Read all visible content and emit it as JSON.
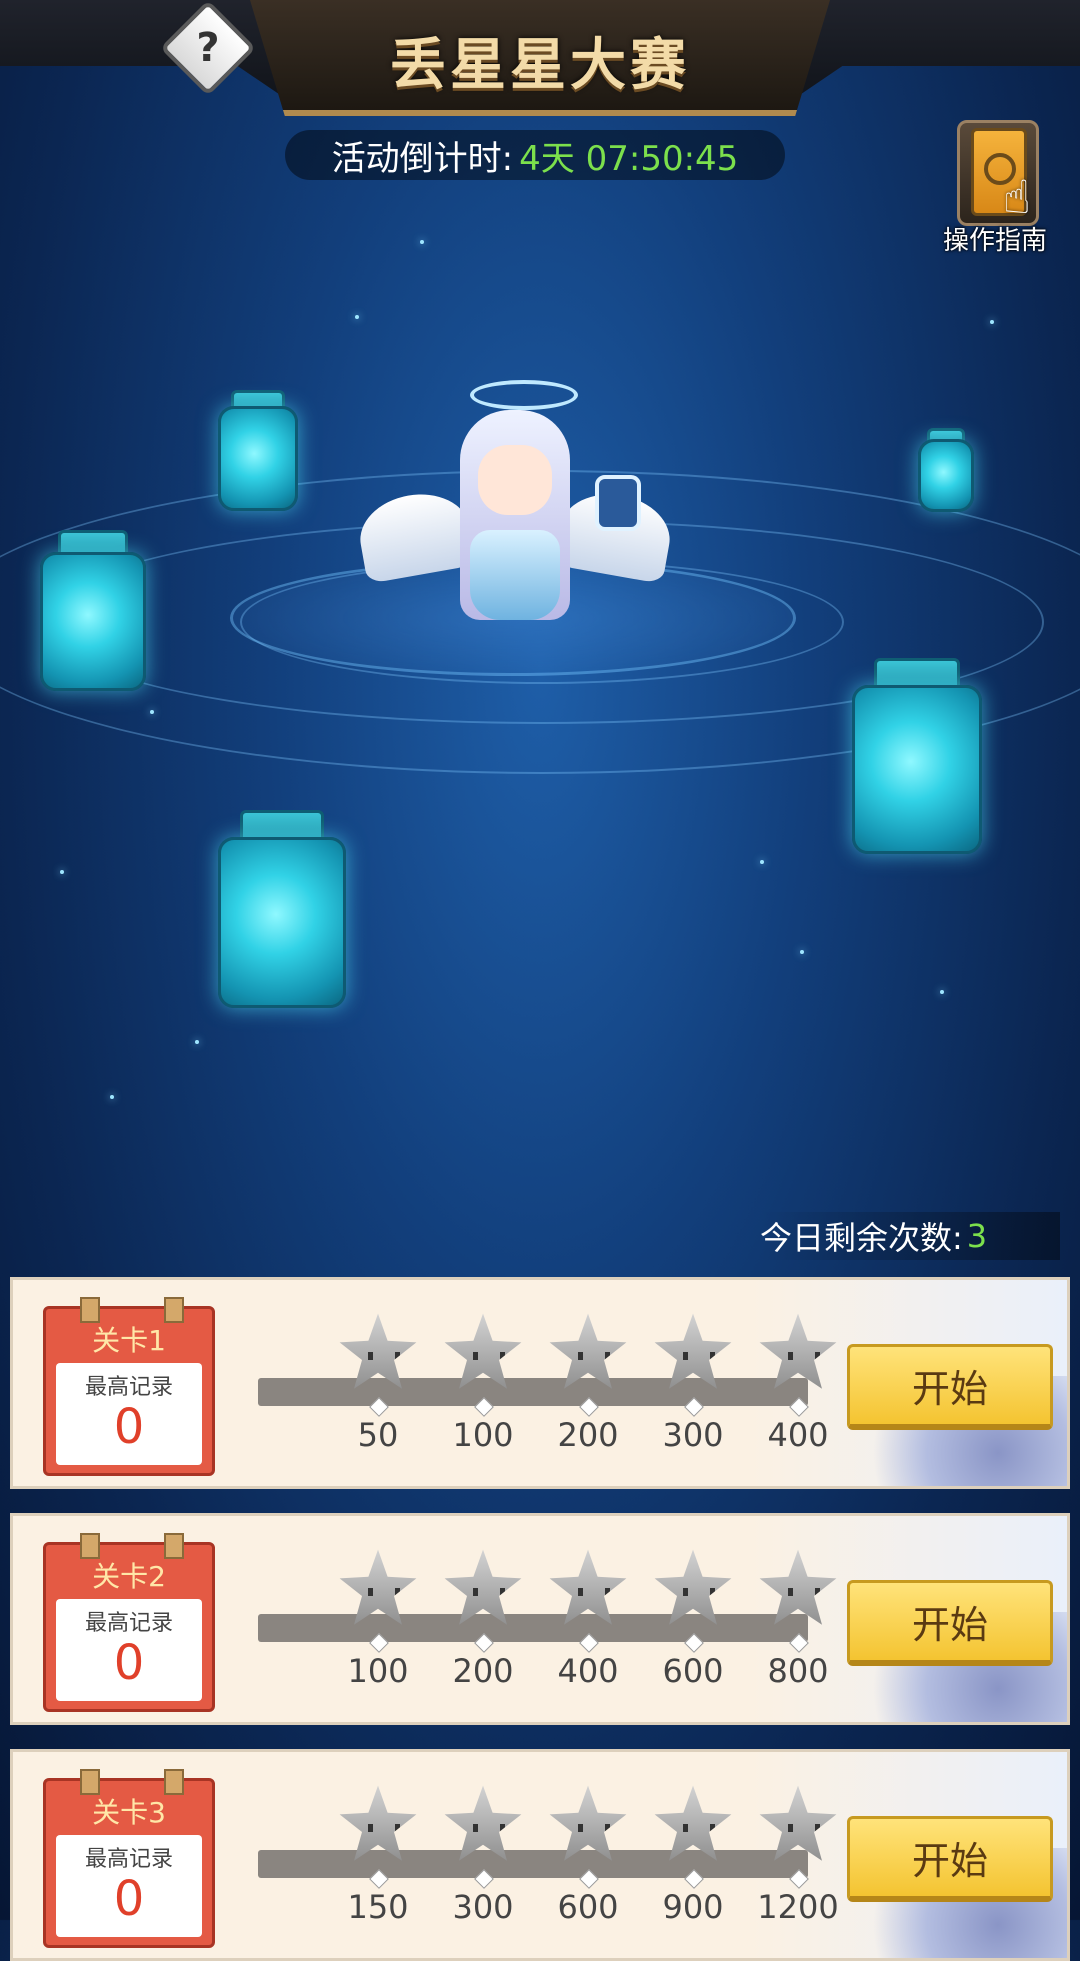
{
  "header": {
    "title": "丢星星大赛",
    "help_icon_glyph": "?",
    "countdown_label": "活动倒计时:",
    "countdown_value": "4天 07:50:45"
  },
  "guide": {
    "label": "操作指南",
    "hand_glyph": "☝"
  },
  "remaining": {
    "label": "今日剩余次数:",
    "value": "3"
  },
  "levels": [
    {
      "name": "关卡1",
      "best_label": "最高记录",
      "best_value": "0",
      "thresholds": [
        "50",
        "100",
        "200",
        "300",
        "400"
      ],
      "start_label": "开始"
    },
    {
      "name": "关卡2",
      "best_label": "最高记录",
      "best_value": "0",
      "thresholds": [
        "100",
        "200",
        "400",
        "600",
        "800"
      ],
      "start_label": "开始"
    },
    {
      "name": "关卡3",
      "best_label": "最高记录",
      "best_value": "0",
      "thresholds": [
        "150",
        "300",
        "600",
        "900",
        "1200"
      ],
      "start_label": "开始"
    }
  ],
  "colors": {
    "countdown_value": "#7ce04c",
    "best_value": "#e0402a",
    "start_button": "#f4c431",
    "level_badge": "#e45a44"
  }
}
